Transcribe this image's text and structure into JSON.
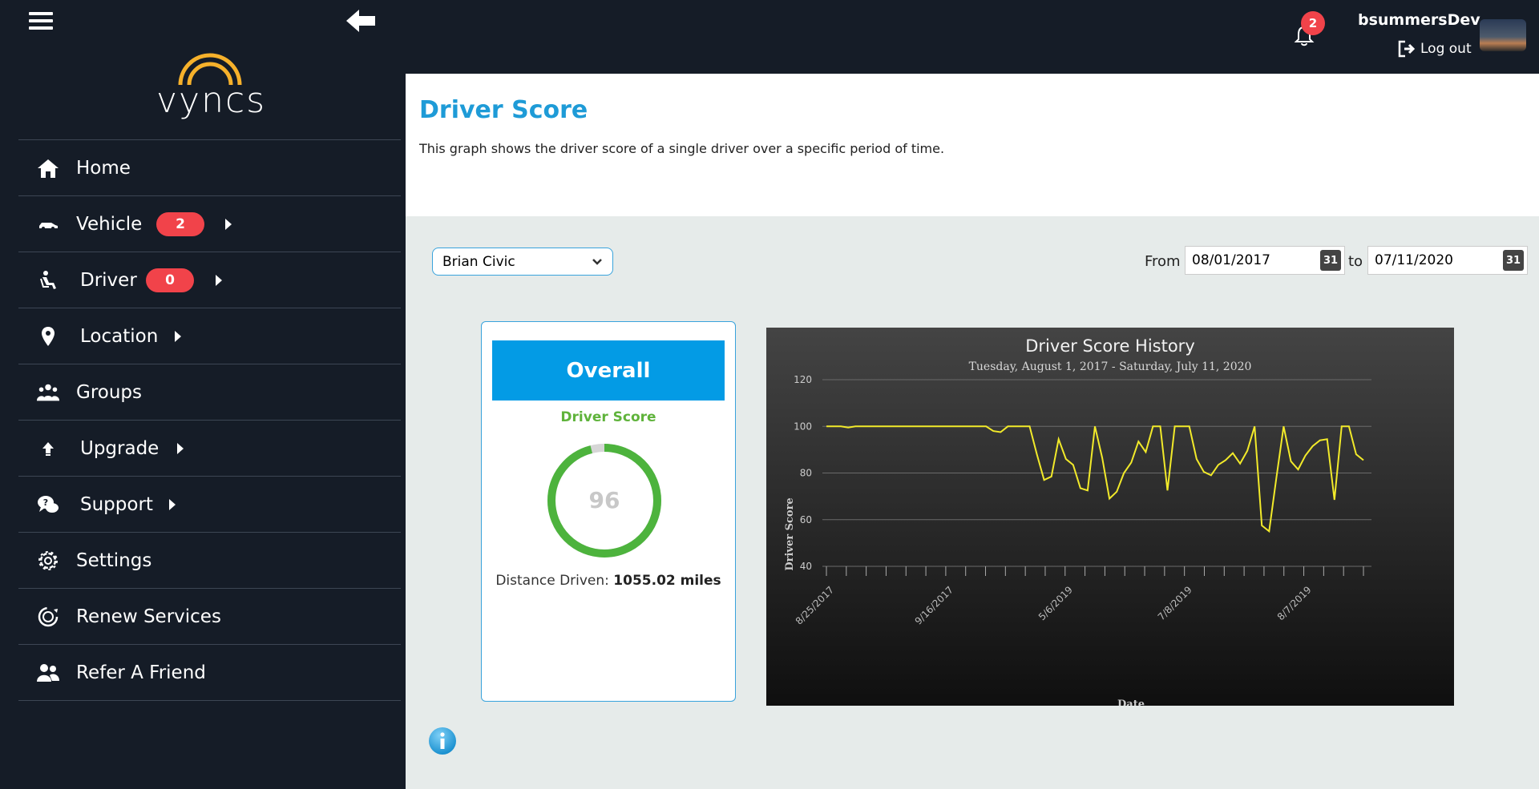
{
  "sidebar": {
    "logo_text": "vyncs",
    "items": [
      {
        "label": "Home"
      },
      {
        "label": "Vehicle",
        "badge": "2"
      },
      {
        "label": "Driver",
        "badge": "0"
      },
      {
        "label": "Location"
      },
      {
        "label": "Groups"
      },
      {
        "label": "Upgrade"
      },
      {
        "label": "Support"
      },
      {
        "label": "Settings"
      },
      {
        "label": "Renew Services"
      },
      {
        "label": "Refer A Friend"
      }
    ]
  },
  "topbar": {
    "notification_count": "2",
    "username": "bsummersDev",
    "logout_label": "Log out"
  },
  "header": {
    "title": "Driver Score",
    "description": "This graph shows the driver score of a single driver over a specific period of time."
  },
  "filters": {
    "vehicle_selected": "Brian Civic",
    "from_label": "From",
    "from_date": "08/01/2017",
    "to_label": "to",
    "to_date": "07/11/2020",
    "calendar_icon_text": "31"
  },
  "score_card": {
    "banner": "Overall",
    "label": "Driver Score",
    "score": "96",
    "score_fraction": 0.96,
    "distance_label": "Distance Driven:",
    "distance_value": "1055.02 miles"
  },
  "colors": {
    "accent_blue": "#039be5",
    "score_green": "#4db33d",
    "badge_red": "#f1434a",
    "line_yellow": "#f2ea2a"
  },
  "chart_data": {
    "type": "line",
    "title": "Driver Score History",
    "subtitle": "Tuesday, August 1, 2017 - Saturday, July 11, 2020",
    "xlabel": "Date",
    "ylabel": "Driver Score",
    "ylim": [
      40,
      120
    ],
    "yticks": [
      40,
      60,
      80,
      100,
      120
    ],
    "x_tick_labels": [
      {
        "label": "8/25/2017",
        "index": 0
      },
      {
        "label": "9/16/2017",
        "index": 6
      },
      {
        "label": "5/6/2019",
        "index": 12
      },
      {
        "label": "7/8/2019",
        "index": 18
      },
      {
        "label": "8/7/2019",
        "index": 24
      }
    ],
    "grid": true,
    "series": [
      {
        "values": [
          100,
          100,
          100,
          99.5,
          100,
          100,
          100,
          100,
          100,
          100,
          100,
          100,
          100,
          100,
          100,
          100,
          100,
          100,
          100,
          100,
          100,
          100,
          100,
          98,
          97.5,
          100,
          100,
          100,
          100,
          88,
          77,
          78.5,
          94.5,
          86,
          83.5,
          73.5,
          72.5,
          100,
          86.5,
          69,
          72,
          80,
          84.5,
          93.5,
          89,
          100,
          100,
          72.5,
          100,
          100,
          100,
          86,
          80.5,
          79,
          83.5,
          85.5,
          88.5,
          84,
          89.5,
          100,
          57.5,
          55,
          78,
          100,
          85,
          81.5,
          87.5,
          91.5,
          94,
          94.5,
          68.5,
          100,
          100,
          88,
          85.5
        ]
      }
    ]
  }
}
